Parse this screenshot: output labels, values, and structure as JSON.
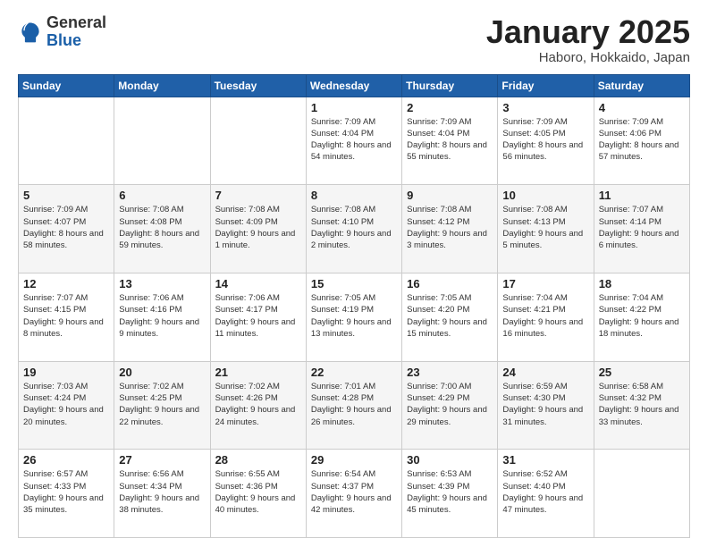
{
  "logo": {
    "general": "General",
    "blue": "Blue"
  },
  "header": {
    "month": "January 2025",
    "location": "Haboro, Hokkaido, Japan"
  },
  "weekdays": [
    "Sunday",
    "Monday",
    "Tuesday",
    "Wednesday",
    "Thursday",
    "Friday",
    "Saturday"
  ],
  "weeks": [
    [
      {
        "day": "",
        "info": ""
      },
      {
        "day": "",
        "info": ""
      },
      {
        "day": "",
        "info": ""
      },
      {
        "day": "1",
        "info": "Sunrise: 7:09 AM\nSunset: 4:04 PM\nDaylight: 8 hours\nand 54 minutes."
      },
      {
        "day": "2",
        "info": "Sunrise: 7:09 AM\nSunset: 4:04 PM\nDaylight: 8 hours\nand 55 minutes."
      },
      {
        "day": "3",
        "info": "Sunrise: 7:09 AM\nSunset: 4:05 PM\nDaylight: 8 hours\nand 56 minutes."
      },
      {
        "day": "4",
        "info": "Sunrise: 7:09 AM\nSunset: 4:06 PM\nDaylight: 8 hours\nand 57 minutes."
      }
    ],
    [
      {
        "day": "5",
        "info": "Sunrise: 7:09 AM\nSunset: 4:07 PM\nDaylight: 8 hours\nand 58 minutes."
      },
      {
        "day": "6",
        "info": "Sunrise: 7:08 AM\nSunset: 4:08 PM\nDaylight: 8 hours\nand 59 minutes."
      },
      {
        "day": "7",
        "info": "Sunrise: 7:08 AM\nSunset: 4:09 PM\nDaylight: 9 hours\nand 1 minute."
      },
      {
        "day": "8",
        "info": "Sunrise: 7:08 AM\nSunset: 4:10 PM\nDaylight: 9 hours\nand 2 minutes."
      },
      {
        "day": "9",
        "info": "Sunrise: 7:08 AM\nSunset: 4:12 PM\nDaylight: 9 hours\nand 3 minutes."
      },
      {
        "day": "10",
        "info": "Sunrise: 7:08 AM\nSunset: 4:13 PM\nDaylight: 9 hours\nand 5 minutes."
      },
      {
        "day": "11",
        "info": "Sunrise: 7:07 AM\nSunset: 4:14 PM\nDaylight: 9 hours\nand 6 minutes."
      }
    ],
    [
      {
        "day": "12",
        "info": "Sunrise: 7:07 AM\nSunset: 4:15 PM\nDaylight: 9 hours\nand 8 minutes."
      },
      {
        "day": "13",
        "info": "Sunrise: 7:06 AM\nSunset: 4:16 PM\nDaylight: 9 hours\nand 9 minutes."
      },
      {
        "day": "14",
        "info": "Sunrise: 7:06 AM\nSunset: 4:17 PM\nDaylight: 9 hours\nand 11 minutes."
      },
      {
        "day": "15",
        "info": "Sunrise: 7:05 AM\nSunset: 4:19 PM\nDaylight: 9 hours\nand 13 minutes."
      },
      {
        "day": "16",
        "info": "Sunrise: 7:05 AM\nSunset: 4:20 PM\nDaylight: 9 hours\nand 15 minutes."
      },
      {
        "day": "17",
        "info": "Sunrise: 7:04 AM\nSunset: 4:21 PM\nDaylight: 9 hours\nand 16 minutes."
      },
      {
        "day": "18",
        "info": "Sunrise: 7:04 AM\nSunset: 4:22 PM\nDaylight: 9 hours\nand 18 minutes."
      }
    ],
    [
      {
        "day": "19",
        "info": "Sunrise: 7:03 AM\nSunset: 4:24 PM\nDaylight: 9 hours\nand 20 minutes."
      },
      {
        "day": "20",
        "info": "Sunrise: 7:02 AM\nSunset: 4:25 PM\nDaylight: 9 hours\nand 22 minutes."
      },
      {
        "day": "21",
        "info": "Sunrise: 7:02 AM\nSunset: 4:26 PM\nDaylight: 9 hours\nand 24 minutes."
      },
      {
        "day": "22",
        "info": "Sunrise: 7:01 AM\nSunset: 4:28 PM\nDaylight: 9 hours\nand 26 minutes."
      },
      {
        "day": "23",
        "info": "Sunrise: 7:00 AM\nSunset: 4:29 PM\nDaylight: 9 hours\nand 29 minutes."
      },
      {
        "day": "24",
        "info": "Sunrise: 6:59 AM\nSunset: 4:30 PM\nDaylight: 9 hours\nand 31 minutes."
      },
      {
        "day": "25",
        "info": "Sunrise: 6:58 AM\nSunset: 4:32 PM\nDaylight: 9 hours\nand 33 minutes."
      }
    ],
    [
      {
        "day": "26",
        "info": "Sunrise: 6:57 AM\nSunset: 4:33 PM\nDaylight: 9 hours\nand 35 minutes."
      },
      {
        "day": "27",
        "info": "Sunrise: 6:56 AM\nSunset: 4:34 PM\nDaylight: 9 hours\nand 38 minutes."
      },
      {
        "day": "28",
        "info": "Sunrise: 6:55 AM\nSunset: 4:36 PM\nDaylight: 9 hours\nand 40 minutes."
      },
      {
        "day": "29",
        "info": "Sunrise: 6:54 AM\nSunset: 4:37 PM\nDaylight: 9 hours\nand 42 minutes."
      },
      {
        "day": "30",
        "info": "Sunrise: 6:53 AM\nSunset: 4:39 PM\nDaylight: 9 hours\nand 45 minutes."
      },
      {
        "day": "31",
        "info": "Sunrise: 6:52 AM\nSunset: 4:40 PM\nDaylight: 9 hours\nand 47 minutes."
      },
      {
        "day": "",
        "info": ""
      }
    ]
  ]
}
